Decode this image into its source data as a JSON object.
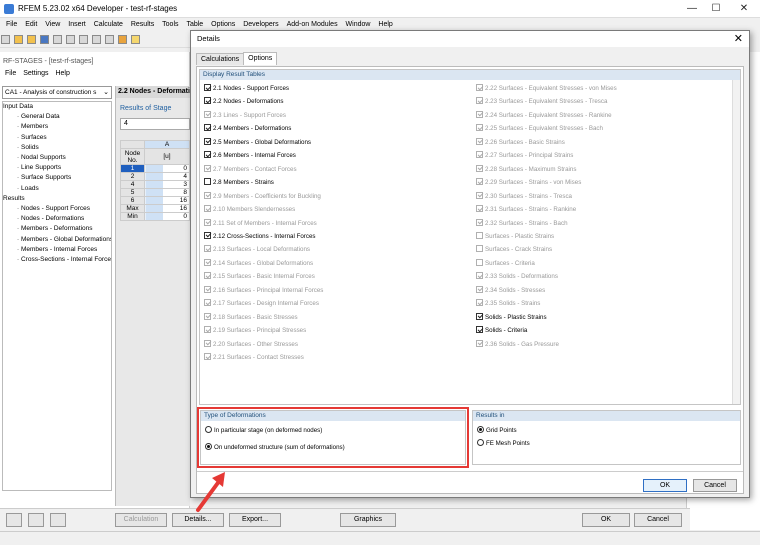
{
  "app": {
    "title": "RFEM 5.23.02 x64 Developer - test-rf-stages",
    "window_controls": [
      "—",
      "☐",
      "✕"
    ]
  },
  "menu": [
    "File",
    "Edit",
    "View",
    "Insert",
    "Calculate",
    "Results",
    "Tools",
    "Table",
    "Options",
    "Developers",
    "Add-on Modules",
    "Window",
    "Help"
  ],
  "rf_stages": {
    "title": "RF-STAGES - [test-rf-stages]",
    "menu": [
      "File",
      "Settings",
      "Help"
    ],
    "case": "CA1 - Analysis of construction s",
    "tree": [
      {
        "label": "Input Data",
        "level": 0
      },
      {
        "label": "General Data",
        "level": 1
      },
      {
        "label": "Members",
        "level": 1
      },
      {
        "label": "Surfaces",
        "level": 1
      },
      {
        "label": "Solids",
        "level": 1
      },
      {
        "label": "Nodal Supports",
        "level": 1
      },
      {
        "label": "Line Supports",
        "level": 1
      },
      {
        "label": "Surface Supports",
        "level": 1
      },
      {
        "label": "Loads",
        "level": 1
      },
      {
        "label": "Results",
        "level": 0
      },
      {
        "label": "Nodes - Support Forces",
        "level": 1
      },
      {
        "label": "Nodes - Deformations",
        "level": 1
      },
      {
        "label": "Members - Deformations",
        "level": 1
      },
      {
        "label": "Members - Global Deformations",
        "level": 1
      },
      {
        "label": "Members - Internal Forces",
        "level": 1
      },
      {
        "label": "Cross-Sections - Internal Force",
        "level": 1
      }
    ],
    "section_title": "2.2 Nodes - Deformati",
    "stage_label": "Results of Stage",
    "stage_value": "4",
    "table": {
      "col_a": "A",
      "header1": "Node",
      "header2": "No.",
      "unit": "[u]",
      "rows": [
        {
          "no": "1",
          "val": "0"
        },
        {
          "no": "2",
          "val": "4"
        },
        {
          "no": "4",
          "val": "3"
        },
        {
          "no": "5",
          "val": "8"
        },
        {
          "no": "6",
          "val": "16"
        },
        {
          "no": "Max",
          "val": "16"
        },
        {
          "no": "Min",
          "val": "0"
        }
      ]
    },
    "buttons": {
      "calculation": "Calculation",
      "details": "Details...",
      "export": "Export...",
      "graphics": "Graphics",
      "ok": "OK",
      "cancel": "Cancel"
    }
  },
  "dialog": {
    "title": "Details",
    "tabs": [
      "Calculations",
      "Options"
    ],
    "active_tab": "Options",
    "display_section": "Display Result Tables",
    "left_column": [
      {
        "label": "2.1 Nodes - Support Forces",
        "checked": true,
        "enabled": true
      },
      {
        "label": "2.2 Nodes - Deformations",
        "checked": true,
        "enabled": true
      },
      {
        "label": "2.3 Lines - Support Forces",
        "checked": true,
        "enabled": false
      },
      {
        "label": "2.4 Members - Deformations",
        "checked": true,
        "enabled": true
      },
      {
        "label": "2.5 Members - Global Deformations",
        "checked": true,
        "enabled": true
      },
      {
        "label": "2.6 Members - Internal Forces",
        "checked": true,
        "enabled": true
      },
      {
        "label": "2.7 Members - Contact Forces",
        "checked": true,
        "enabled": false
      },
      {
        "label": "2.8 Members - Strains",
        "checked": false,
        "enabled": true
      },
      {
        "label": "2.9 Members - Coefficients for Buckling",
        "checked": true,
        "enabled": false
      },
      {
        "label": "2.10 Members Slendernesses",
        "checked": true,
        "enabled": false
      },
      {
        "label": "2.11 Set of Members - Internal Forces",
        "checked": true,
        "enabled": false
      },
      {
        "label": "2.12 Cross-Sections - Internal Forces",
        "checked": true,
        "enabled": true
      },
      {
        "label": "2.13 Surfaces - Local Deformations",
        "checked": true,
        "enabled": false
      },
      {
        "label": "2.14 Surfaces - Global Deformations",
        "checked": true,
        "enabled": false
      },
      {
        "label": "2.15 Surfaces - Basic Internal Forces",
        "checked": true,
        "enabled": false
      },
      {
        "label": "2.16 Surfaces - Principal Internal Forces",
        "checked": true,
        "enabled": false
      },
      {
        "label": "2.17 Surfaces - Design Internal Forces",
        "checked": true,
        "enabled": false
      },
      {
        "label": "2.18 Surfaces - Basic Stresses",
        "checked": true,
        "enabled": false
      },
      {
        "label": "2.19 Surfaces - Principal Stresses",
        "checked": true,
        "enabled": false
      },
      {
        "label": "2.20 Surfaces - Other Stresses",
        "checked": true,
        "enabled": false
      },
      {
        "label": "2.21 Surfaces - Contact Stresses",
        "checked": true,
        "enabled": false
      }
    ],
    "right_column": [
      {
        "label": "2.22 Surfaces - Equivalent Stresses - von Mises",
        "checked": true,
        "enabled": false
      },
      {
        "label": "2.23 Surfaces - Equivalent Stresses - Tresca",
        "checked": true,
        "enabled": false
      },
      {
        "label": "2.24 Surfaces - Equivalent Stresses - Rankine",
        "checked": true,
        "enabled": false
      },
      {
        "label": "2.25 Surfaces - Equivalent Stresses - Bach",
        "checked": true,
        "enabled": false
      },
      {
        "label": "2.26 Surfaces - Basic Strains",
        "checked": true,
        "enabled": false
      },
      {
        "label": "2.27 Surfaces - Principal Strains",
        "checked": true,
        "enabled": false
      },
      {
        "label": "2.28 Surfaces - Maximum Strains",
        "checked": true,
        "enabled": false
      },
      {
        "label": "2.29 Surfaces - Strains - von Mises",
        "checked": true,
        "enabled": false
      },
      {
        "label": "2.30 Surfaces - Strains - Tresca",
        "checked": true,
        "enabled": false
      },
      {
        "label": "2.31 Surfaces - Strains - Rankine",
        "checked": true,
        "enabled": false
      },
      {
        "label": "2.32 Surfaces - Strains - Bach",
        "checked": true,
        "enabled": false
      },
      {
        "label": "Surfaces - Plastic Strains",
        "checked": false,
        "enabled": false
      },
      {
        "label": "Surfaces - Crack Strains",
        "checked": false,
        "enabled": false
      },
      {
        "label": "Surfaces - Criteria",
        "checked": false,
        "enabled": false
      },
      {
        "label": "2.33 Solids - Deformations",
        "checked": true,
        "enabled": false
      },
      {
        "label": "2.34 Solids - Stresses",
        "checked": true,
        "enabled": false
      },
      {
        "label": "2.35 Solids - Strains",
        "checked": true,
        "enabled": false
      },
      {
        "label": "Solids - Plastic Strains",
        "checked": true,
        "enabled": true
      },
      {
        "label": "Solids - Criteria",
        "checked": true,
        "enabled": true
      },
      {
        "label": "2.36 Solids - Gas Pressure",
        "checked": true,
        "enabled": false
      }
    ],
    "deformations_section": "Type of Deformations",
    "deformations_options": [
      {
        "label": "In particular stage (on deformed nodes)",
        "selected": false
      },
      {
        "label": "On undeformed structure (sum of deformations)",
        "selected": true
      }
    ],
    "results_section": "Results in",
    "results_options": [
      {
        "label": "Grid Points",
        "selected": true
      },
      {
        "label": "FE Mesh Points",
        "selected": false
      }
    ],
    "ok": "OK",
    "cancel": "Cancel",
    "highlight_color": "#e53935"
  }
}
